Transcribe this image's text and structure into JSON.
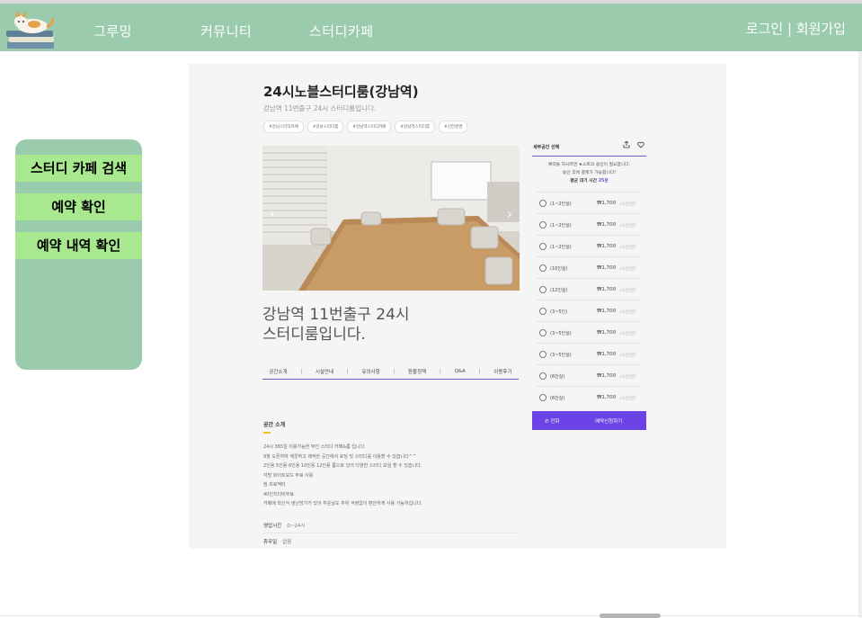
{
  "header": {
    "nav": [
      "그루밍",
      "커뮤니티",
      "스터디카페"
    ],
    "auth": "로그인 | 회원가입",
    "brand_color": "#9acbac"
  },
  "sidebar": {
    "items": [
      {
        "label": "스터디 카페 검색"
      },
      {
        "label": "예약 확인"
      },
      {
        "label": "예약 내역 확인"
      }
    ],
    "button_color": "#a8e88e"
  },
  "detail": {
    "title": "24시노블스터디룸(강남역)",
    "subtitle": "강남역 11번출구 24시 스터디룸입니다.",
    "tags": [
      "#강남스터디카페",
      "#강남스터디룸",
      "#강남역스터디카페",
      "#강남역스터디룸",
      "#신전엔엔"
    ],
    "description_line1": "강남역 11번출구 24시",
    "description_line2": "스터디룸입니다.",
    "tabs": [
      "공간소개",
      "시설안내",
      "유의사항",
      "환불정책",
      "Q&A",
      "이용후기"
    ],
    "section_title": "공간 소개",
    "body_lines": [
      "24시 365일 이용가능한 무인 스터디 카페&룸 입니다.",
      "9월 오픈하여 깨끗하고 쾌적한 공간에서 로딩 및 스터디를 이용할 수 있습니다^^",
      "2인용 5인용 6인용 10인용 12인용 룸으로 있어 다양한 스터디 모임 할 수 있습니다.",
      "각방 화이트보드 무료 사용",
      "빔 프로젝터",
      "40인치티비무료",
      "카페에 최신식 냉난방기가 있어 추운날도 추위 걱정없이 편안하게 사용 가능하십니다."
    ],
    "hours_label": "영업시간",
    "hours_value": "0~24시",
    "holiday_label": "휴무일",
    "holiday_value": "없음"
  },
  "booking": {
    "heading": "세부공간 선택",
    "share_icon": "share-icon",
    "heart_icon": "heart-icon",
    "info_line1": "예약을 하시려면 ★스트의 승인이 필요합니다.",
    "info_line2": "승인 후에 결제가 가능합니다!",
    "wait_label": "평균 대기 시간",
    "wait_value": "25분",
    "options": [
      {
        "label": "(1~2인실)",
        "price": "₩1,700",
        "unit": "/시간(인)"
      },
      {
        "label": "(1~2인실)",
        "price": "₩1,700",
        "unit": "/시간(인)"
      },
      {
        "label": "(1~2인실)",
        "price": "₩1,700",
        "unit": "/시간(인)"
      },
      {
        "label": "(10인실)",
        "price": "₩1,700",
        "unit": "/시간(인)"
      },
      {
        "label": "(12인실)",
        "price": "₩1,700",
        "unit": "/시간(인)"
      },
      {
        "label": "(3~5인)",
        "price": "₩1,700",
        "unit": "/시간(인)"
      },
      {
        "label": "(3~5인실)",
        "price": "₩1,700",
        "unit": "/시간(인)"
      },
      {
        "label": "(3~5인실)",
        "price": "₩1,700",
        "unit": "/시간(인)"
      },
      {
        "label": "(6인실)",
        "price": "₩1,700",
        "unit": "/시간(인)"
      },
      {
        "label": "(6인실)",
        "price": "₩1,700",
        "unit": "/시간(인)"
      }
    ],
    "call_label": "전화",
    "book_label": "예약신청하기",
    "button_color": "#6b42e6"
  }
}
